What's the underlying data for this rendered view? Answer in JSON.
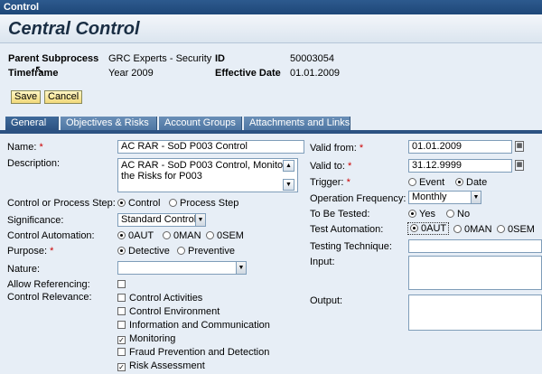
{
  "window": {
    "title": "Control"
  },
  "header": {
    "title": "Central Control"
  },
  "info": {
    "parent_subprocess_label": "Parent Subprocess",
    "parent_subprocess_value": "GRC Experts - Security",
    "id_label": "ID",
    "id_value": "50003054",
    "timeframe_label": "Timeframe",
    "timeframe_value": "Year 2009",
    "effective_date_label": "Effective Date",
    "effective_date_value": "01.01.2009"
  },
  "toolbar": {
    "save_label": "Save",
    "cancel_label": "Cancel"
  },
  "tabs": [
    {
      "label": "General"
    },
    {
      "label": "Objectives & Risks"
    },
    {
      "label": "Account Groups"
    },
    {
      "label": "Attachments and Links"
    }
  ],
  "form": {
    "name_label": "Name:",
    "name_value": "AC RAR - SoD P003 Control",
    "description_label": "Description:",
    "description_value": "AC RAR - SoD P003 Control, Monitor the Risks for P003",
    "control_step_label": "Control or Process Step:",
    "control_step_opt1": "Control",
    "control_step_opt2": "Process Step",
    "significance_label": "Significance:",
    "significance_value": "Standard Control",
    "control_automation_label": "Control Automation:",
    "automation_opt1": "0AUT",
    "automation_opt2": "0MAN",
    "automation_opt3": "0SEM",
    "purpose_label": "Purpose:",
    "purpose_opt1": "Detective",
    "purpose_opt2": "Preventive",
    "nature_label": "Nature:",
    "nature_value": "",
    "allow_referencing_label": "Allow Referencing:",
    "control_relevance_label": "Control Relevance:",
    "relevance": [
      {
        "label": "Control Activities",
        "checked": false
      },
      {
        "label": "Control Environment",
        "checked": false
      },
      {
        "label": "Information and Communication",
        "checked": false
      },
      {
        "label": "Monitoring",
        "checked": true
      },
      {
        "label": "Fraud Prevention and Detection",
        "checked": false
      },
      {
        "label": "Risk Assessment",
        "checked": true
      }
    ],
    "valid_from_label": "Valid from:",
    "valid_from_value": "01.01.2009",
    "valid_to_label": "Valid to:",
    "valid_to_value": "31.12.9999",
    "trigger_label": "Trigger:",
    "trigger_opt1": "Event",
    "trigger_opt2": "Date",
    "operation_frequency_label": "Operation Frequency:",
    "operation_frequency_value": "Monthly",
    "to_be_tested_label": "To Be Tested:",
    "tested_opt1": "Yes",
    "tested_opt2": "No",
    "test_automation_label": "Test Automation:",
    "test_auto_opt1": "0AUT",
    "test_auto_opt2": "0MAN",
    "test_auto_opt3": "0SEM",
    "testing_technique_label": "Testing Technique:",
    "input_label": "Input:",
    "output_label": "Output:"
  }
}
